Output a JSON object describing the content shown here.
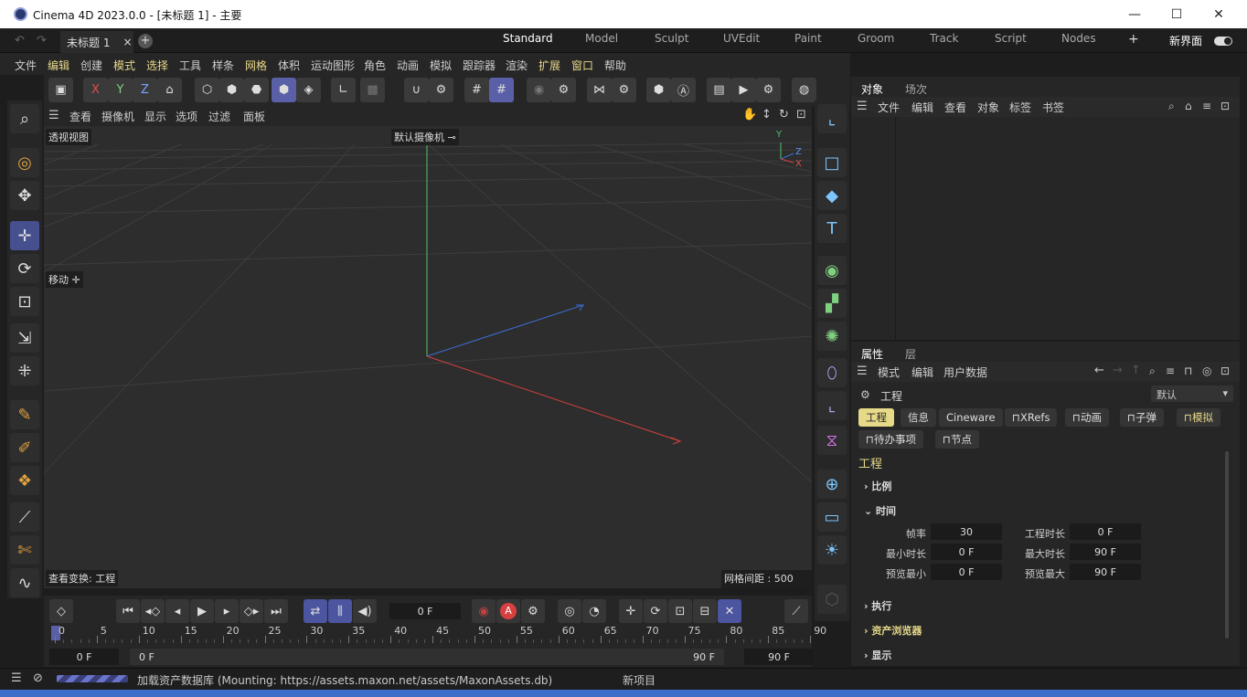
{
  "window": {
    "title": "Cinema 4D 2023.0.0 - [未标题 1] - 主要",
    "minimize": "—",
    "maximize": "☐",
    "close": "✕"
  },
  "doc_tab": {
    "label": "未标题 1",
    "close": "×",
    "add": "+"
  },
  "layouts": [
    "Standard",
    "Model",
    "Sculpt",
    "UVEdit",
    "Paint",
    "Groom",
    "Track",
    "Script",
    "Nodes"
  ],
  "layout_add": "+",
  "new_interface": "新界面",
  "menu": [
    {
      "label": "文件",
      "hl": false
    },
    {
      "label": "编辑",
      "hl": true
    },
    {
      "label": "创建",
      "hl": false
    },
    {
      "label": "模式",
      "hl": true
    },
    {
      "label": "选择",
      "hl": true
    },
    {
      "label": "工具",
      "hl": false
    },
    {
      "label": "样条",
      "hl": false
    },
    {
      "label": "网格",
      "hl": true
    },
    {
      "label": "体积",
      "hl": false
    },
    {
      "label": "运动图形",
      "hl": false
    },
    {
      "label": "角色",
      "hl": false
    },
    {
      "label": "动画",
      "hl": false
    },
    {
      "label": "模拟",
      "hl": false
    },
    {
      "label": "跟踪器",
      "hl": false
    },
    {
      "label": "渲染",
      "hl": false
    },
    {
      "label": "扩展",
      "hl": true
    },
    {
      "label": "窗口",
      "hl": true
    },
    {
      "label": "帮助",
      "hl": false
    }
  ],
  "toolbar": {
    "x": "X",
    "y": "Y",
    "z": "Z"
  },
  "viewport_menu": [
    "查看",
    "摄像机",
    "显示",
    "选项",
    "过滤",
    "面板"
  ],
  "viewport": {
    "view_name": "透视视图",
    "camera": "默认摄像机",
    "tool_hint": "移动",
    "transform": "查看变换: 工程",
    "grid_spacing": "网格间距 : 500 cm",
    "axis_y": "Y",
    "axis_z": "Z",
    "axis_x": "X"
  },
  "timeline": {
    "current_frame": "0 F",
    "ticks": [
      "0",
      "5",
      "10",
      "15",
      "20",
      "25",
      "30",
      "35",
      "40",
      "45",
      "50",
      "55",
      "60",
      "65",
      "70",
      "75",
      "80",
      "85",
      "90"
    ],
    "start": "0 F",
    "range_start": "0 F",
    "range_end": "90 F",
    "end": "90 F",
    "auto_key": "A"
  },
  "status": {
    "message": "加载资产数据库 (Mounting: https://assets.maxon.net/assets/MaxonAssets.db)",
    "project": "新项目"
  },
  "object_panel": {
    "tabs": [
      "对象",
      "场次"
    ],
    "menu": [
      "文件",
      "编辑",
      "查看",
      "对象",
      "标签",
      "书签"
    ]
  },
  "attr_panel": {
    "tabs": [
      "属性",
      "层"
    ],
    "menu": [
      "模式",
      "编辑",
      "用户数据"
    ],
    "object_name": "工程",
    "preset": "默认",
    "chips_row1": [
      {
        "label": "工程",
        "state": "on"
      },
      {
        "label": "信息",
        "state": ""
      },
      {
        "label": "Cineware",
        "state": ""
      },
      {
        "label": "XRefs",
        "state": ""
      },
      {
        "label": "动画",
        "state": ""
      },
      {
        "label": "子弹",
        "state": ""
      },
      {
        "label": "模拟",
        "state": "hl"
      }
    ],
    "chips_row2": [
      "待办事项",
      "节点"
    ],
    "section_title": "工程",
    "groups": {
      "scale": "比例",
      "time": "时间",
      "execute": "执行",
      "asset_browser": "资产浏览器",
      "display": "显示"
    },
    "fields": {
      "fps_label": "帧率",
      "fps": "30",
      "project_length_label": "工程时长",
      "project_length": "0 F",
      "min_time_label": "最小时长",
      "min_time": "0 F",
      "max_time_label": "最大时长",
      "max_time": "90 F",
      "preview_min_label": "预览最小",
      "preview_min": "0 F",
      "preview_max_label": "预览最大",
      "preview_max": "90 F"
    }
  },
  "colors": {
    "accent": "#5a60a8",
    "highlight": "#e6d988",
    "axis_x": "#e05050",
    "axis_y": "#50d070",
    "axis_z": "#4a7fe0"
  }
}
